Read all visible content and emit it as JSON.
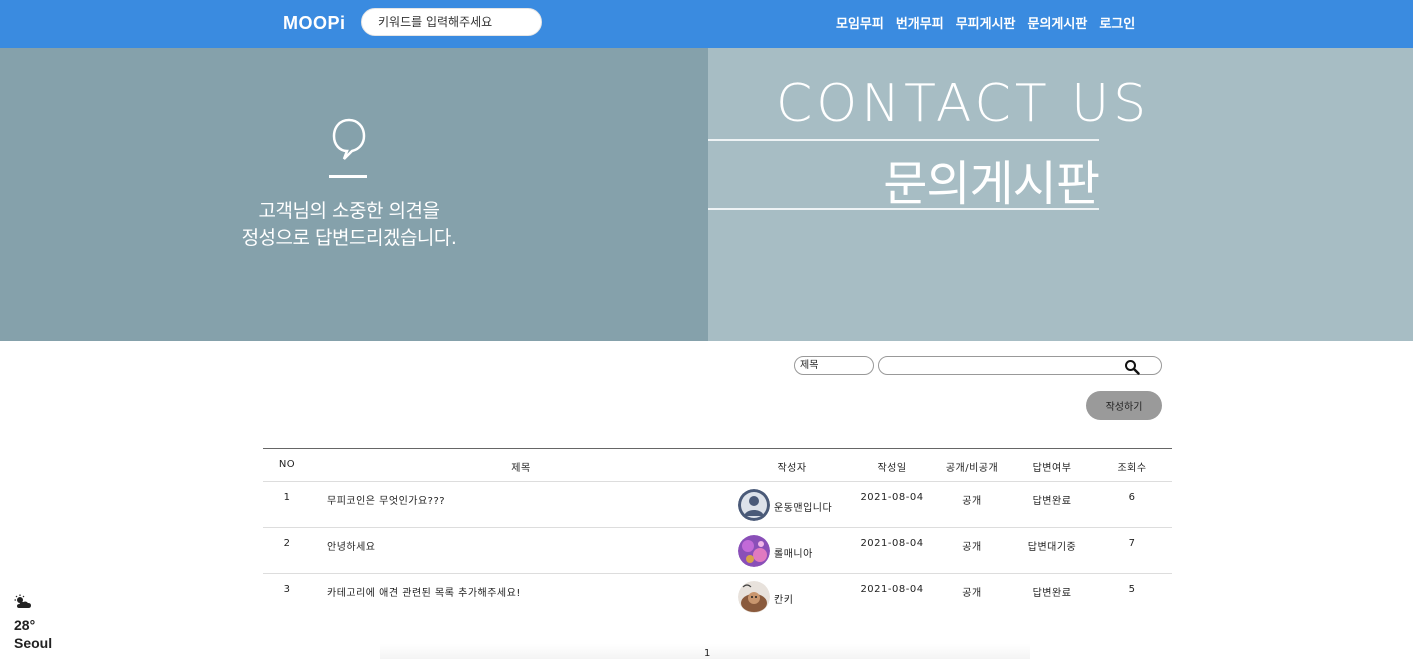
{
  "header": {
    "logo": "MOOPi",
    "search_placeholder": "키워드를 입력해주세요",
    "nav": [
      "모임무피",
      "번개무피",
      "무피게시판",
      "문의게시판",
      "로그인"
    ]
  },
  "banner": {
    "message_line1": "고객님의 소중한 의견을",
    "message_line2": "정성으로 답변드리겠습니다.",
    "title_en": "CONTACT US",
    "title_ko": "문의게시판"
  },
  "search": {
    "field_selected": "제목",
    "keyword_value": "",
    "write_label": "작성하기"
  },
  "table": {
    "headers": {
      "no": "NO",
      "title": "제목",
      "author": "작성자",
      "date": "작성일",
      "visibility": "공개/비공개",
      "answered": "답변여부",
      "views": "조회수"
    },
    "rows": [
      {
        "no": "1",
        "title": "무피코인은 무엇인가요???",
        "author": "운동맨입니다",
        "date": "2021-08-04",
        "visibility": "공개",
        "answered": "답변완료",
        "views": "6",
        "avatar": "default-profile-icon"
      },
      {
        "no": "2",
        "title": "안녕하세요",
        "author": "롤매니아",
        "date": "2021-08-04",
        "visibility": "공개",
        "answered": "답변대기중",
        "views": "7",
        "avatar": "purple-photo"
      },
      {
        "no": "3",
        "title": "카테고리에 애견 관련된 목록 추가해주세요!",
        "author": "칸키",
        "date": "2021-08-04",
        "visibility": "공개",
        "answered": "답변완료",
        "views": "5",
        "avatar": "dog-photo"
      }
    ]
  },
  "pagination": {
    "current": "1"
  },
  "weather": {
    "icon": "partly-cloudy-icon",
    "temp": "28°",
    "city": "Seoul"
  },
  "colors": {
    "header": "#3a8be0",
    "banner_left": "#85a1ab",
    "banner_right": "#a7bdc4",
    "write_button": "#9a9a9a"
  }
}
